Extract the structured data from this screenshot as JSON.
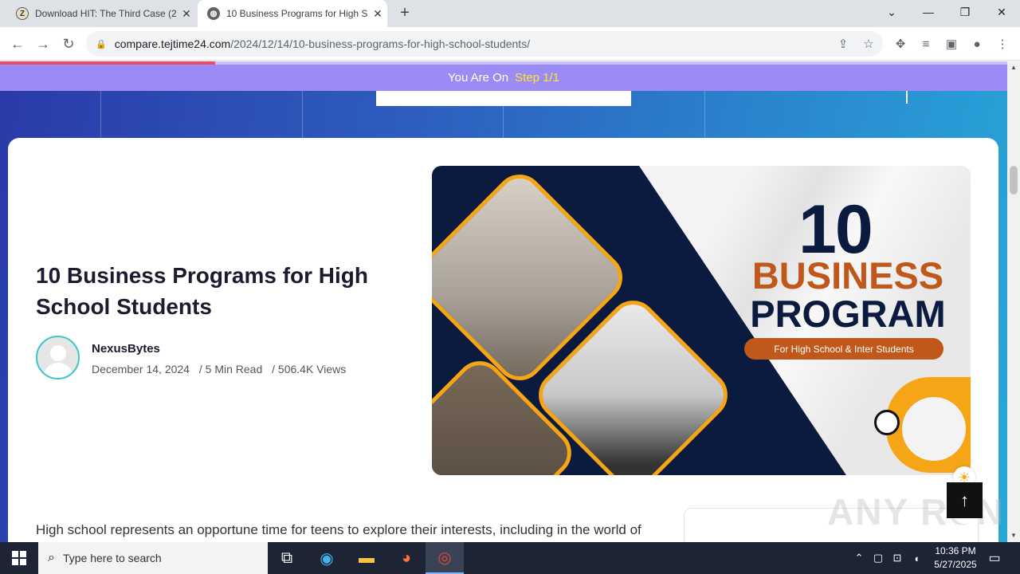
{
  "browser": {
    "tabs": [
      {
        "title": "Download HIT: The Third Case (2",
        "favicon": "Z",
        "active": false
      },
      {
        "title": "10 Business Programs for High S",
        "favicon": "globe",
        "active": true
      }
    ],
    "url_domain": "compare.tejtime24.com",
    "url_path": "/2024/12/14/10-business-programs-for-high-school-students/"
  },
  "page": {
    "stepbar": {
      "prefix": "You Are On",
      "step": "Step 1/1"
    },
    "post": {
      "title": "10 Business Programs for High School Students",
      "author": "NexusBytes",
      "date": "December 14, 2024",
      "read_time": "/ 5 Min Read",
      "views": "/ 506.4K Views"
    },
    "hero": {
      "number": "10",
      "line1": "BUSINESS",
      "line2": "PROGRAM",
      "pill": "For High School & Inter Students"
    },
    "paragraph": "High school represents an opportune time for teens to explore their interests, including in the world of business. A number of programs enable high school students to get exposed to",
    "watermark": "ANY RUN"
  },
  "taskbar": {
    "search_placeholder": "Type here to search",
    "time": "10:36 PM",
    "date": "5/27/2025"
  },
  "colors": {
    "accent_orange": "#c0581b",
    "navy": "#0b1a3f",
    "stepbar": "#9b8cf5",
    "step_highlight": "#ffe533"
  }
}
